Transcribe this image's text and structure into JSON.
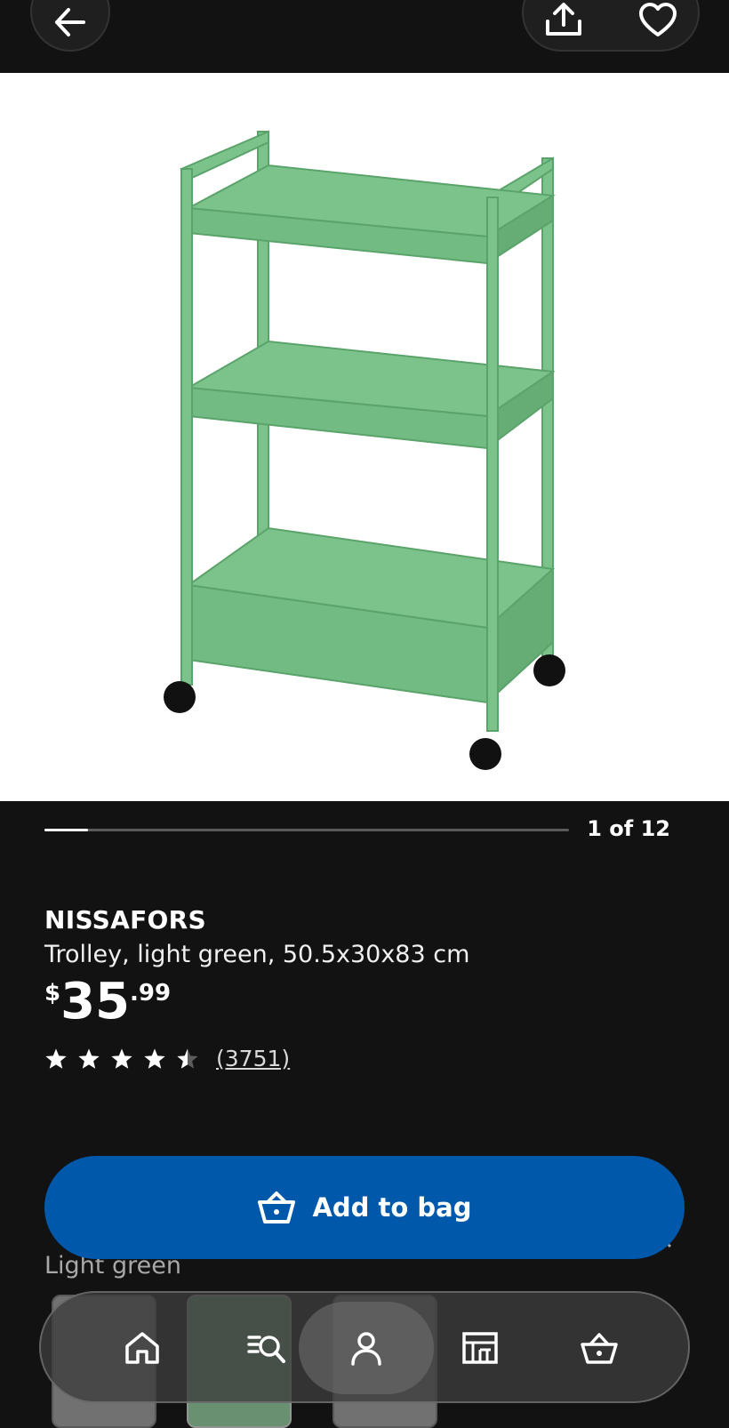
{
  "product": {
    "name": "NISSAFORS",
    "description": "Trolley, light green, 50.5x30x83 cm",
    "price": {
      "currency": "$",
      "integer": "35",
      "decimal": ".99"
    },
    "rating": {
      "value": 4.5,
      "max": 5,
      "review_count": "(3751)"
    },
    "image_color": "#7cc38b"
  },
  "gallery": {
    "counter": "1 of 12",
    "current": 1,
    "total": 12
  },
  "actions": {
    "add_to_bag_label": "Add to bag"
  },
  "color_section": {
    "selected_label": "Light green"
  },
  "nav": {
    "items": [
      {
        "icon": "home-icon"
      },
      {
        "icon": "search-icon"
      },
      {
        "icon": "profile-icon"
      },
      {
        "icon": "store-icon"
      },
      {
        "icon": "basket-icon"
      }
    ],
    "active": "profile-icon"
  },
  "colors": {
    "accent": "#0058ab",
    "background": "#121212"
  }
}
